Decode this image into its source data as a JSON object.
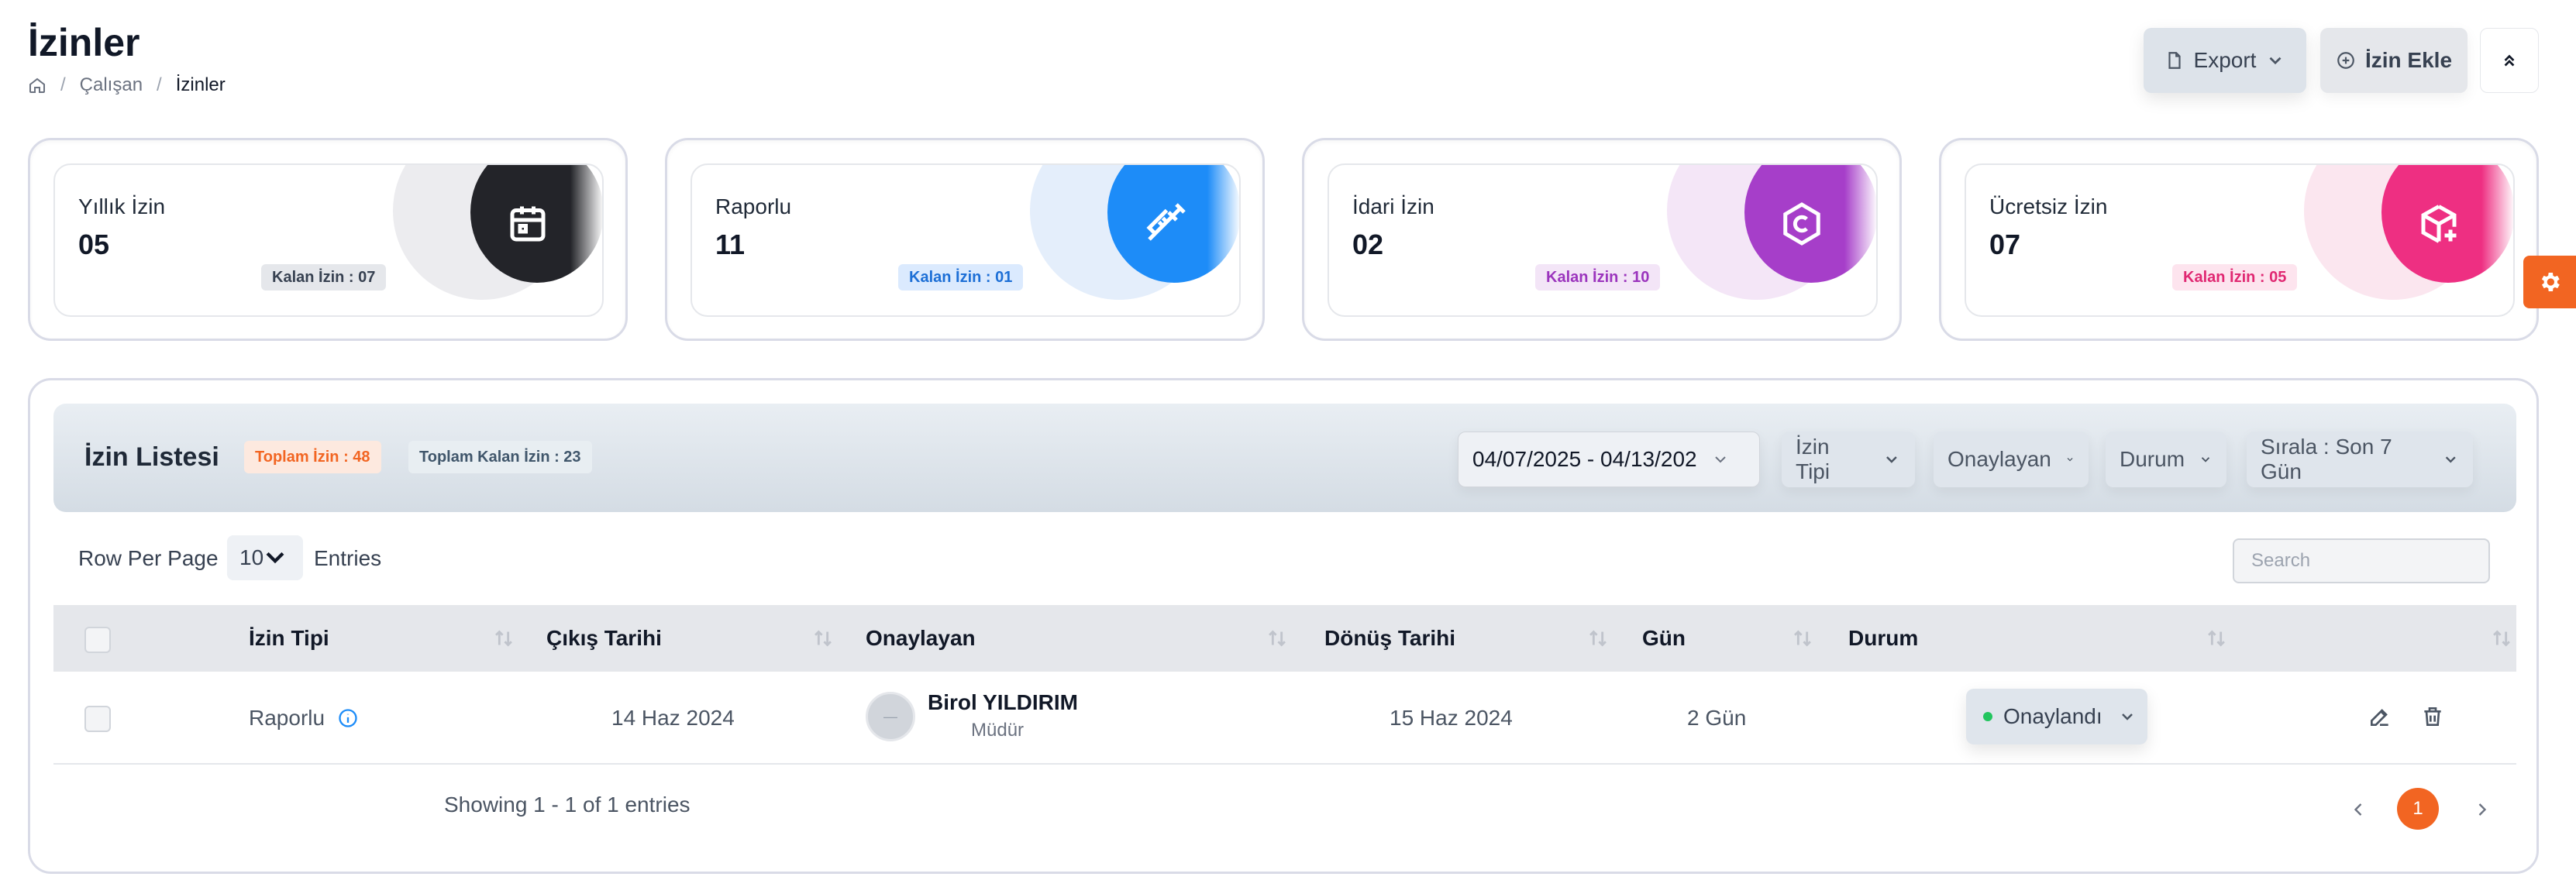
{
  "header": {
    "title": "İzinler",
    "breadcrumb": [
      "Çalışan",
      "İzinler"
    ],
    "export_label": "Export",
    "add_label": "İzin Ekle"
  },
  "stats": [
    {
      "label": "Yıllık İzin",
      "value": "05",
      "badge": "Kalan İzin : 07",
      "icon": "calendar-icon",
      "color": "#1f2937"
    },
    {
      "label": "Raporlu",
      "value": "11",
      "badge": "Kalan İzin : 01",
      "icon": "syringe-icon",
      "color": "#1d8cf8"
    },
    {
      "label": "İdari İzin",
      "value": "02",
      "badge": "Kalan İzin : 10",
      "icon": "hexagon-c-icon",
      "color": "#a63ec9"
    },
    {
      "label": "Ücretsiz İzin",
      "value": "07",
      "badge": "Kalan İzin : 05",
      "icon": "box-plus-icon",
      "color": "#ee2f82"
    }
  ],
  "list": {
    "title": "İzin Listesi",
    "total_pill": "Toplam İzin : 48",
    "remaining_pill": "Toplam Kalan İzin : 23",
    "filters": {
      "date_range": "04/07/2025 - 04/13/202",
      "type": "İzin Tipi",
      "approver": "Onaylayan",
      "status": "Durum",
      "sort": "Sırala : Son 7 Gün"
    },
    "rows_per_page_label": "Row Per Page",
    "rows_per_page_value": "10",
    "entries_label": "Entries",
    "search_placeholder": "Search",
    "columns": [
      "İzin Tipi",
      "Çıkış Tarihi",
      "Onaylayan",
      "Dönüş Tarihi",
      "Gün",
      "Durum"
    ],
    "rows": [
      {
        "type": "Raporlu",
        "start": "14 Haz 2024",
        "approver_name": "Birol YILDIRIM",
        "approver_role": "Müdür",
        "end": "15 Haz 2024",
        "days": "2 Gün",
        "status": "Onaylandı"
      }
    ],
    "showing": "Showing 1 - 1 of 1 entries",
    "current_page": "1"
  },
  "colors": {
    "accent": "#f26522",
    "success": "#22c55e"
  }
}
